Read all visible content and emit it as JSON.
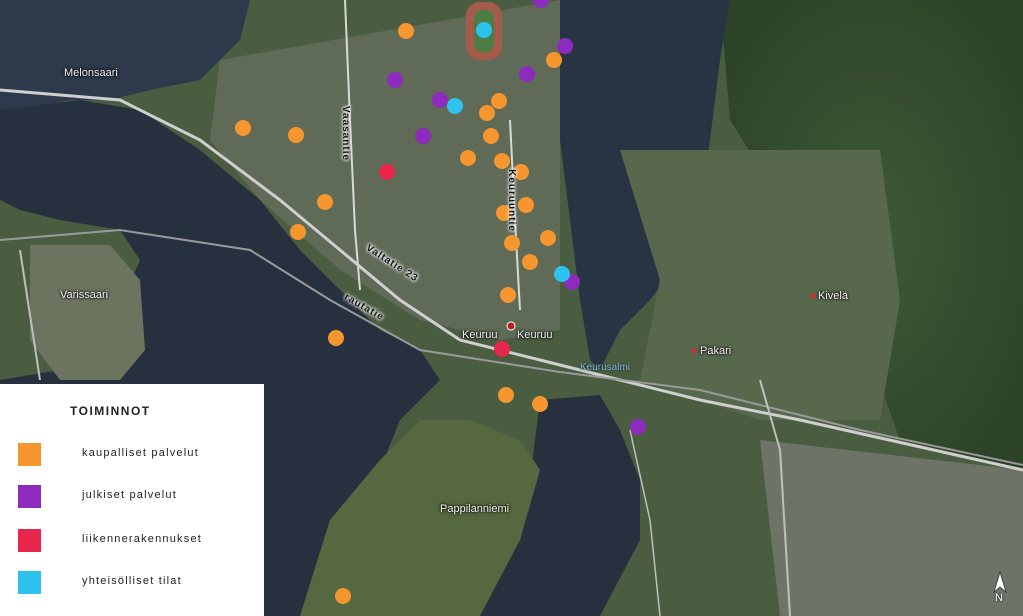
{
  "colors": {
    "commercial": "#f5962e",
    "public": "#8e2bbf",
    "transport": "#e8254a",
    "community": "#2ec3ee"
  },
  "place_labels": {
    "melonsaari": "Melonsaari",
    "varissaari": "Varissaari",
    "keuruu_a": "Keuruu",
    "keuruu_b": "Keuruu",
    "pakari": "Pakari",
    "kivela": "Kivelä",
    "pappilanniemi": "Pappilanniemi"
  },
  "road_labels": {
    "vaasantie": "Vaasantie",
    "keuruuntie": "Keuruuntie",
    "valtatie": "Valtatie 23",
    "rautatie": "rautatie"
  },
  "water_labels": {
    "salmi": "Keurusalmi"
  },
  "legend": {
    "title": "TOIMINNOT",
    "items": [
      {
        "key": "commercial",
        "label": "kaupalliset palvelut"
      },
      {
        "key": "public",
        "label": "julkiset palvelut"
      },
      {
        "key": "transport",
        "label": "liikennerakennukset"
      },
      {
        "key": "community",
        "label": "yhteisölliset tilat"
      }
    ]
  },
  "north_label": "N"
}
